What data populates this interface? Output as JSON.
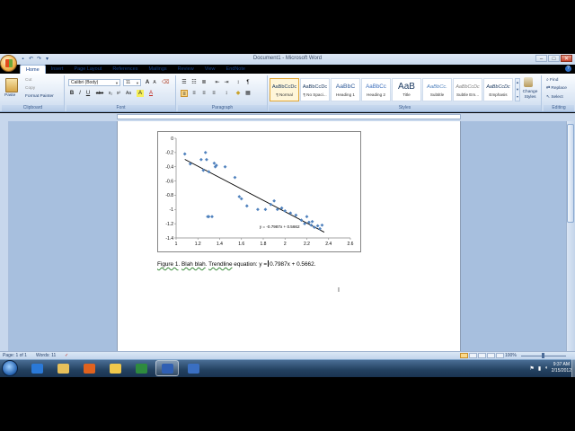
{
  "window": {
    "title": "Document1 - Microsoft Word",
    "controls": [
      "–",
      "□",
      "✕"
    ]
  },
  "quick_access": {
    "icons": [
      "save-icon",
      "undo-icon",
      "redo-icon",
      "customize-icon"
    ],
    "glyphs": [
      "▪",
      "↶",
      "↷",
      "▾"
    ]
  },
  "ribbon": {
    "tabs": [
      "Home",
      "Insert",
      "Page Layout",
      "References",
      "Mailings",
      "Review",
      "View",
      "EndNote"
    ],
    "active_tab": "Home",
    "help": "?",
    "clipboard": {
      "label": "Clipboard",
      "paste": "Paste",
      "cut": "Cut",
      "copy": "Copy",
      "format_painter": "Format Painter"
    },
    "font": {
      "label": "Font",
      "font_name": "Calibri (Body)",
      "font_size": "11",
      "buttons": [
        "B",
        "I",
        "U",
        "abe",
        "x₂",
        "x²",
        "Aa",
        "A",
        "A"
      ]
    },
    "paragraph": {
      "label": "Paragraph"
    },
    "styles": {
      "label": "Styles",
      "items": [
        {
          "preview": "AaBbCcDc",
          "name": "¶ Normal",
          "active": true
        },
        {
          "preview": "AaBbCcDc",
          "name": "¶ No Spaci...",
          "active": false
        },
        {
          "preview": "AaBbC",
          "name": "Heading 1",
          "active": false
        },
        {
          "preview": "AaBbCc",
          "name": "Heading 2",
          "active": false
        },
        {
          "preview": "AaB",
          "name": "Title",
          "active": false
        },
        {
          "preview": "AaBbCc.",
          "name": "Subtitle",
          "active": false
        },
        {
          "preview": "AaBbCcDc",
          "name": "Subtle Em...",
          "active": false
        },
        {
          "preview": "AaBbCcDc",
          "name": "Emphasis",
          "active": false
        }
      ],
      "change_styles": "Change Styles"
    },
    "editing": {
      "label": "Editing",
      "find": "Find",
      "replace": "Replace",
      "select": "Select"
    }
  },
  "document": {
    "caption_parts": [
      "Figure 1",
      ".  ",
      "Blah blah",
      ".  ",
      "Trendline",
      " equation: y =",
      "0.7987x + 0.5662."
    ],
    "cursor_glyph": "I"
  },
  "chart_data": {
    "type": "scatter",
    "title": "",
    "xlabel": "",
    "ylabel": "",
    "xlim": [
      1,
      2.6
    ],
    "ylim": [
      -1.4,
      0
    ],
    "xticks": [
      "1",
      "1.2",
      "1.4",
      "1.6",
      "1.8",
      "2",
      "2.2",
      "2.4",
      "2.6"
    ],
    "yticks": [
      "0",
      "-0.2",
      "-0.4",
      "-0.6",
      "-0.8",
      "-1",
      "-1.2",
      "-1.4"
    ],
    "series": [
      {
        "marker_color": "#4f81bd",
        "points": [
          [
            1.08,
            -0.22
          ],
          [
            1.13,
            -0.36
          ],
          [
            1.23,
            -0.3
          ],
          [
            1.25,
            -0.45
          ],
          [
            1.27,
            -0.2
          ],
          [
            1.28,
            -0.3
          ],
          [
            1.3,
            -0.47
          ],
          [
            1.35,
            -0.35
          ],
          [
            1.36,
            -0.4
          ],
          [
            1.37,
            -0.38
          ],
          [
            1.45,
            -0.4
          ],
          [
            1.54,
            -0.55
          ],
          [
            1.58,
            -0.82
          ],
          [
            1.6,
            -0.85
          ],
          [
            1.65,
            -0.95
          ],
          [
            1.75,
            -1.0
          ],
          [
            1.82,
            -1.0
          ],
          [
            1.87,
            -0.93
          ],
          [
            1.9,
            -0.88
          ],
          [
            1.93,
            -1.0
          ],
          [
            1.97,
            -0.98
          ],
          [
            2.0,
            -1.02
          ],
          [
            2.05,
            -1.05
          ],
          [
            2.1,
            -1.08
          ],
          [
            2.15,
            -1.15
          ],
          [
            2.18,
            -1.2
          ],
          [
            2.2,
            -1.1
          ],
          [
            2.22,
            -1.18
          ],
          [
            2.24,
            -1.22
          ],
          [
            2.25,
            -1.17
          ],
          [
            2.27,
            -1.25
          ],
          [
            2.3,
            -1.23
          ],
          [
            2.32,
            -1.27
          ],
          [
            2.34,
            -1.22
          ],
          [
            1.29,
            -1.1
          ],
          [
            1.33,
            -1.1
          ],
          [
            1.3,
            -1.1
          ]
        ]
      }
    ],
    "trendline": {
      "slope": -0.7987,
      "intercept": 0.5662,
      "x_range": [
        1.08,
        2.36
      ],
      "color": "#000000"
    },
    "annotation": "y = -0.7987x + 0.5662"
  },
  "statusbar": {
    "page": "Page: 1 of 1",
    "words": "Words: 11",
    "zoom": "100%"
  },
  "taskbar": {
    "apps": [
      {
        "icon": "ie-icon",
        "color": "#2a79d8"
      },
      {
        "icon": "explorer-folder-icon",
        "color": "#e7c05a"
      },
      {
        "icon": "firefox-icon",
        "color": "#e0621e"
      },
      {
        "icon": "folder-icon",
        "color": "#f0c84c"
      },
      {
        "icon": "excel-icon",
        "color": "#2e8b3e"
      },
      {
        "icon": "word-icon",
        "color": "#2f5fb3",
        "active": true
      },
      {
        "icon": "save-disk-icon",
        "color": "#3a6fc2"
      }
    ],
    "time": "9:37 AM",
    "date": "2/15/2012"
  }
}
